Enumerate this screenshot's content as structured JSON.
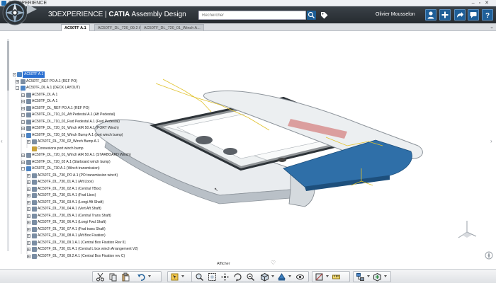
{
  "window": {
    "title": "3DEXPERIENCE"
  },
  "header": {
    "brand": "3DEXPERIENCE",
    "separator": " | ",
    "product_bold": "CATIA",
    "product_rest": " Assembly Design",
    "search_placeholder": "Rechercher",
    "user_name": "Olivier Mousselon"
  },
  "tabs": [
    {
      "label": "AC50TF A.1"
    },
    {
      "label": "AC50TF_DL_720_09.2 A.1"
    },
    {
      "label": "AC50TF_DL_720_01_Winch A..."
    }
  ],
  "tree": [
    {
      "label": "AC50TF A.1",
      "level": 0,
      "expander": "-",
      "icon": "assembly-icon"
    },
    {
      "label": "AC50TF_REF PO A.1 (REF PO)",
      "level": 1,
      "expander": "+",
      "icon": "part-icon"
    },
    {
      "label": "AC50TF_DL A.1 (DECK LAYOUT)",
      "level": 1,
      "expander": "-",
      "icon": "assembly-icon"
    },
    {
      "label": "AC50TF_DL A.1",
      "level": 2,
      "expander": "+",
      "icon": "part-icon"
    },
    {
      "label": "AC50TF_DL A.1",
      "level": 2,
      "expander": "+",
      "icon": "part-icon"
    },
    {
      "label": "AC50TF_DL_REF PO A.1 (REF PO)",
      "level": 2,
      "expander": "+",
      "icon": "part-icon"
    },
    {
      "label": "AC50TF_DL_710_01_Aft Pedestal A.1 (Aft Pedestal)",
      "level": 2,
      "expander": "+",
      "icon": "part-icon"
    },
    {
      "label": "AC50TF_DL_710_02_Fwd Pedestal A.1 (Fwd Pedestal)",
      "level": 2,
      "expander": "+",
      "icon": "part-icon"
    },
    {
      "label": "AC50TF_DL_720_01_Winch AIR 50 A.1 (PORT Winch)",
      "level": 2,
      "expander": "+",
      "icon": "part-icon"
    },
    {
      "label": "AC50TF_DL_720_02_Winch Bump A.1 (port winch bump)",
      "level": 2,
      "expander": "-",
      "icon": "assembly-icon"
    },
    {
      "label": "AC50TF_DL_720_02_Winch Bump A.1",
      "level": 3,
      "expander": "+",
      "icon": "part-icon"
    },
    {
      "label": "Connexions port winch bump",
      "level": 3,
      "expander": "",
      "icon": "connection-icon"
    },
    {
      "label": "AC50TF_DL_720_01_Winch AIR 50 A.1 (STARBOARD Winch)",
      "level": 2,
      "expander": "+",
      "icon": "part-icon"
    },
    {
      "label": "AC50TF_DL_720_02 A.1 (Starboard winch bump)",
      "level": 2,
      "expander": "+",
      "icon": "part-icon"
    },
    {
      "label": "AC50TF_DL_730 A.1 (Winch transmission)",
      "level": 2,
      "expander": "-",
      "icon": "assembly-icon"
    },
    {
      "label": "AC50TF_DL_730_PO A.1 (PO transmission winch)",
      "level": 3,
      "expander": "+",
      "icon": "part-icon"
    },
    {
      "label": "AC50TF_DL_730_01 A.1 (Aft Lbox)",
      "level": 3,
      "expander": "+",
      "icon": "part-icon"
    },
    {
      "label": "AC50TF_DL_730_02 A.1 (Central TBox)",
      "level": 3,
      "expander": "+",
      "icon": "part-icon"
    },
    {
      "label": "AC50TF_DL_730_01 A.1 (Fwd Lbox)",
      "level": 3,
      "expander": "+",
      "icon": "part-icon"
    },
    {
      "label": "AC50TF_DL_730_03 A.1 (Longi Aft Shaft)",
      "level": 3,
      "expander": "+",
      "icon": "part-icon"
    },
    {
      "label": "AC50TF_DL_730_04 A.1 (Vert Aft Shaft)",
      "level": 3,
      "expander": "+",
      "icon": "part-icon"
    },
    {
      "label": "AC50TF_DL_730_05 A.1 (Central Trans Shaft)",
      "level": 3,
      "expander": "+",
      "icon": "part-icon"
    },
    {
      "label": "AC50TF_DL_730_06 A.1 (Longi Fwd Shaft)",
      "level": 3,
      "expander": "+",
      "icon": "part-icon"
    },
    {
      "label": "AC50TF_DL_730_07 A.1 (Fwd trans Shaft)",
      "level": 3,
      "expander": "+",
      "icon": "part-icon"
    },
    {
      "label": "AC50TF_DL_730_08 A.1 (Aft Box Fixation)",
      "level": 3,
      "expander": "+",
      "icon": "part-icon"
    },
    {
      "label": "AC50TF_DL_730_09.1 A.1 (Central Box Fixation Rev II)",
      "level": 3,
      "expander": "+",
      "icon": "part-icon"
    },
    {
      "label": "AC50TF_DL_730_01 A.1 (Central L box winch Arrangement V2)",
      "level": 3,
      "expander": "+",
      "icon": "part-icon"
    },
    {
      "label": "AC50TF_DL_730_09.2 A.1 (Central Box Fixation rev C)",
      "level": 3,
      "expander": "+",
      "icon": "part-icon"
    }
  ],
  "action_bar": {
    "section_label": "Afficher",
    "page_dots": 4,
    "active_dot": 0
  },
  "colors": {
    "header_bg": "#2e343a",
    "accent_blue": "#1f5f98",
    "hull_blue": "#2f6fa8",
    "tree_selection": "#2a6fd1"
  }
}
